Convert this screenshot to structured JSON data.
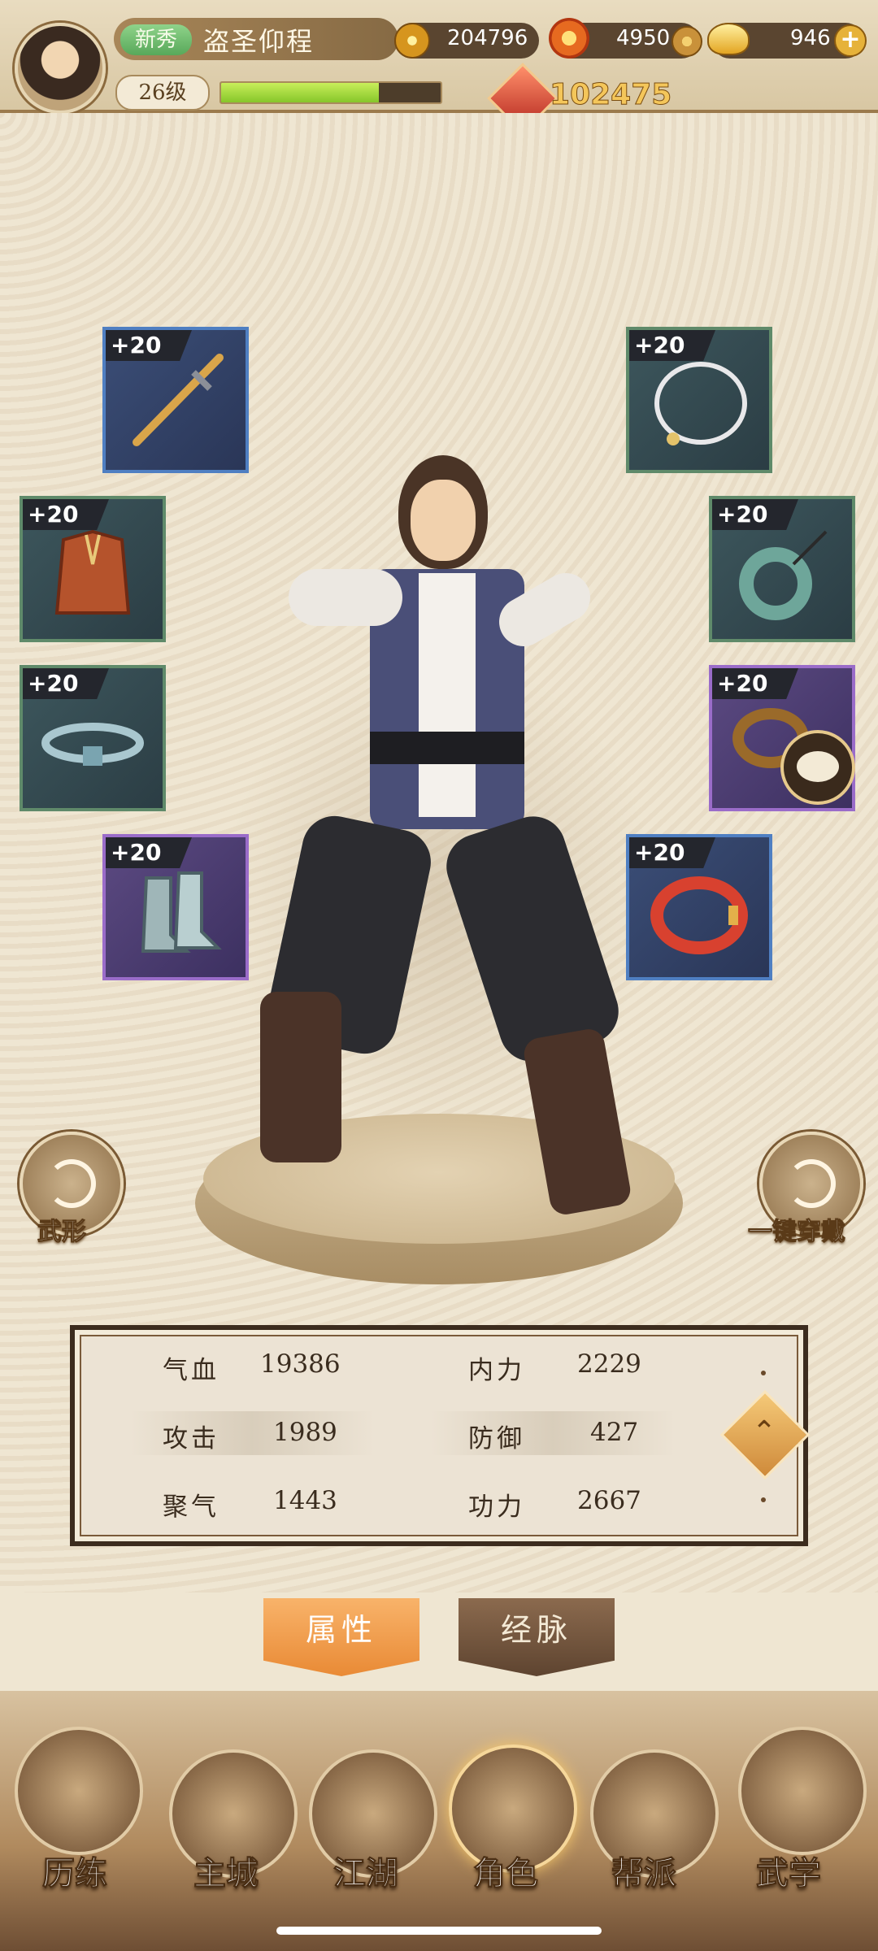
{
  "player": {
    "rank_badge": "新秀",
    "name": "盗圣仰程",
    "level": "26级",
    "xp_fraction": 0.72,
    "power": "102475"
  },
  "resources": {
    "coins": "204796",
    "flames": "4950",
    "ingots": "946"
  },
  "equipment": {
    "left": [
      {
        "name": "sword",
        "level": "+20",
        "rarity": "blue"
      },
      {
        "name": "armor",
        "level": "+20",
        "rarity": "green"
      },
      {
        "name": "belt",
        "level": "+20",
        "rarity": "green"
      },
      {
        "name": "boots",
        "level": "+20",
        "rarity": "purple"
      }
    ],
    "right": [
      {
        "name": "necklace",
        "level": "+20",
        "rarity": "green"
      },
      {
        "name": "jade-pendant",
        "level": "+20",
        "rarity": "green"
      },
      {
        "name": "ring",
        "level": "+20",
        "rarity": "purple"
      },
      {
        "name": "bracelet",
        "level": "+20",
        "rarity": "blue"
      }
    ]
  },
  "actions": {
    "martial_form": "武形",
    "equip_all": "一键穿戴"
  },
  "stats": {
    "hp_label": "气血",
    "hp_value": "19386",
    "inner_label": "内力",
    "inner_value": "2229",
    "atk_label": "攻击",
    "atk_value": "1989",
    "def_label": "防御",
    "def_value": "427",
    "focus_label": "聚气",
    "focus_value": "1443",
    "skill_label": "功力",
    "skill_value": "2667"
  },
  "tabs": {
    "attributes": "属性",
    "meridians": "经脉"
  },
  "nav": [
    {
      "label": "历练"
    },
    {
      "label": "主城"
    },
    {
      "label": "江湖"
    },
    {
      "label": "角色"
    },
    {
      "label": "帮派"
    },
    {
      "label": "武学"
    }
  ]
}
